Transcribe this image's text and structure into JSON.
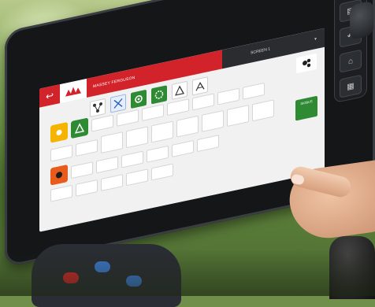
{
  "screen": {
    "title": "MASSEY FERGUSON",
    "tab": "SCREEN 1",
    "side_label": "LOAD",
    "green_tag": "ISOBUS"
  },
  "hardware_buttons": [
    "menu-icon",
    "return-icon",
    "home-icon",
    "grid-icon"
  ],
  "colors": {
    "brand_red": "#d2232a",
    "status_green": "#2f8a34",
    "warning_yellow": "#f5b400",
    "accent_orange": "#e85b1a"
  }
}
